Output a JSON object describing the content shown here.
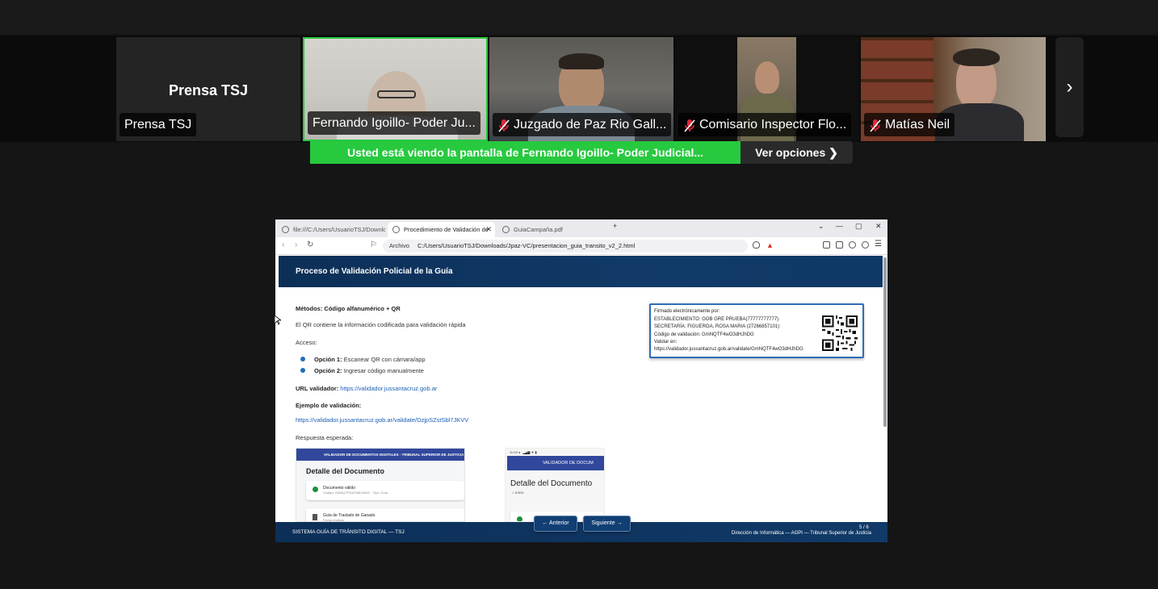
{
  "participants": [
    {
      "tile_label": "Prensa TSJ",
      "name": "Prensa TSJ",
      "muted": false,
      "video": false
    },
    {
      "name": "Fernando Igoillo- Poder Ju...",
      "muted": false,
      "video": true,
      "active_speaker": true
    },
    {
      "name": "Juzgado de Paz Rio Gall...",
      "muted": true,
      "video": true
    },
    {
      "name": "Comisario Inspector Flo...",
      "muted": true,
      "video": true
    },
    {
      "name": "Matías Neil",
      "muted": true,
      "video": true
    }
  ],
  "next_arrow": "›",
  "share_banner": {
    "text": "Usted está viendo la pantalla de  Fernando Igoillo- Poder Judicial...",
    "options_label": "Ver opciones ❯",
    "color": "#27c93f"
  },
  "browser": {
    "tabs": [
      {
        "label": "file:///C:/Users/UsuarioTSJ/Downloa"
      },
      {
        "label": "Procedimiento de Validación de",
        "active": true
      },
      {
        "label": "GuiaCampaña.pdf"
      }
    ],
    "new_tab": "+",
    "win_controls": [
      "⌄",
      "—",
      "▢",
      "✕"
    ],
    "url_prefix": "Archivo",
    "url": "C:/Users/UsuarioTSJ/Downloads/Jpaz-VC/presentacion_guia_transito_v2_2.html"
  },
  "slide": {
    "header": "Proceso de Validación Policial de la Guía",
    "methods": "Métodos: Código alfanumérico + QR",
    "qr_info": "El QR contiene la información codificada para validación rápida",
    "access_label": "Acceso:",
    "options": [
      {
        "label": "Opción 1:",
        "text": "Escanear QR con cámara/app"
      },
      {
        "label": "Opción 2:",
        "text": "Ingresar código manualmente"
      }
    ],
    "url_validator_label": "URL validador:",
    "url_validator": "https://validador.jussantacruz.gob.ar",
    "example_label": "Ejemplo de validación:",
    "example_url": "https://validador.jussantacruz.gob.ar/validate/DzjpSZstSbl7JKVV",
    "expected_label": "Respuesta esperada:",
    "signature": {
      "line1": "Firmado electrónicamente por:",
      "line2": "ESTABLECIMIENTO: GOB GRE PRUEBA(77777777777)",
      "line3": "SECRETARÍA: FIGUEROA, ROSA MARIA (27266857101)",
      "line4": "Código de validación: GmNQTF4wO3dHJhDG",
      "line5": "Validar en:",
      "line6": "https://validador.jussantacruz.gob.ar/validate/GmNQTF4wO3dHJhDG"
    },
    "shot1": {
      "header": "VALIDADOR DE DOCUMENTOS DIGITALES - TRIBUNAL SUPERIOR DE JUSTICIA",
      "title": "Detalle del Documento",
      "card1_title": "Documento válido",
      "card1_sub": "Código: GmNQTF4wO3dHJhDG · Tipo: Guía",
      "card2_title": "Guía de Traslado de Ganado",
      "card2_sub": "Fecha emisión"
    },
    "shot2": {
      "status": "11:09 ◂ ·                ▂▄▆ ▼ ▮",
      "header": "VALIDADOR DE DOCUM",
      "title": "Detalle del Documento",
      "breadcrumb": "Inicio"
    },
    "prev_button": "← Anterior",
    "next_button": "Siguiente →",
    "page_counter": "5 / 6",
    "footer_left": "SISTEMA GUÍA DE TRÁNSITO DIGITAL — TSJ",
    "footer_right": "Dirección de Informática — AGPI — Tribunal Superior de Justicia"
  }
}
